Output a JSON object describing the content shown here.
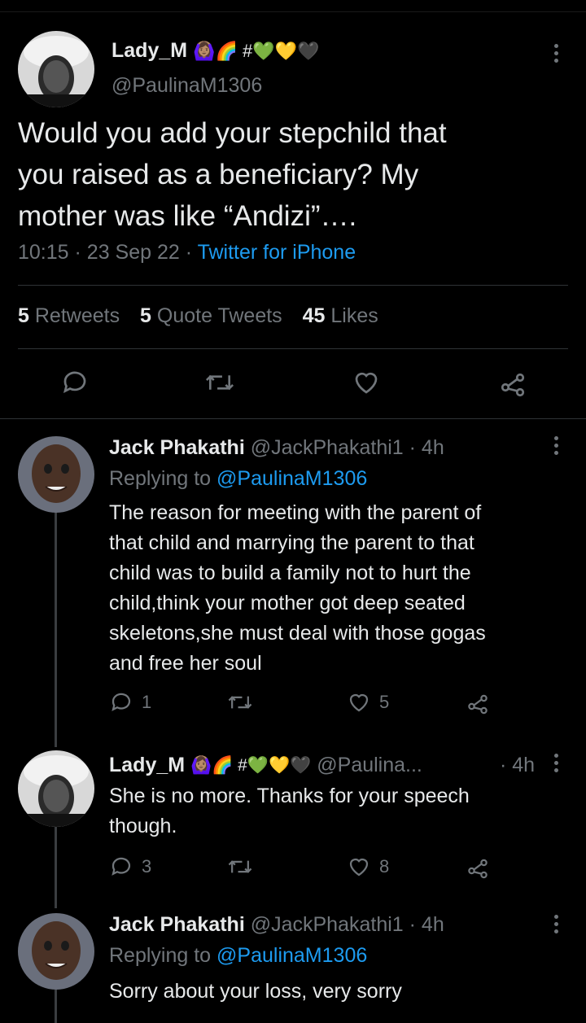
{
  "main_tweet": {
    "display_name": "Lady_M",
    "name_emoji": "🙆🏽‍♀️🌈 #💚💛🖤",
    "handle": "@PaulinaM1306",
    "text_lines": [
      "Would you add your stepchild that",
      "you raised as a beneficiary? My",
      "mother was like “Andizi”…."
    ],
    "time": "10:15",
    "dot1": "·",
    "date": "23 Sep 22",
    "dot2": "·",
    "source": "Twitter for iPhone",
    "retweets_count": "5",
    "retweets_label": "Retweets",
    "quotes_count": "5",
    "quotes_label": "Quote Tweets",
    "likes_count": "45",
    "likes_label": "Likes"
  },
  "replies": [
    {
      "display_name": "Jack Phakathi",
      "handle": "@JackPhakathi1",
      "time": "· 4h",
      "replying_prefix": "Replying to",
      "replying_handle": "@PaulinaM1306",
      "text_lines": [
        "The reason for meeting with the parent of",
        "that child and marrying the parent to that",
        "child was to build a family not to hurt the",
        "child,think your mother got deep seated",
        "skeletons,she must deal with those gogas",
        "and free her soul"
      ],
      "reply_count": "1",
      "retweet_count": "",
      "like_count": "5"
    },
    {
      "display_name": "Lady_M",
      "name_emoji": "🙆🏽‍♀️🌈 #💚💛🖤",
      "handle": "@Paulina...",
      "time": "· 4h",
      "text_lines": [
        "She is no more. Thanks for your speech",
        "though."
      ],
      "reply_count": "3",
      "retweet_count": "",
      "like_count": "8"
    },
    {
      "display_name": "Jack Phakathi",
      "handle": "@JackPhakathi1",
      "time": "· 4h",
      "replying_prefix": "Replying to",
      "replying_handle": "@PaulinaM1306",
      "text_lines": [
        "Sorry about your loss, very sorry"
      ]
    }
  ],
  "colors": {
    "background": "#000000",
    "text": "#e7e9ea",
    "muted": "#71767b",
    "link": "#1d9bf0",
    "separator": "#2f3336"
  }
}
